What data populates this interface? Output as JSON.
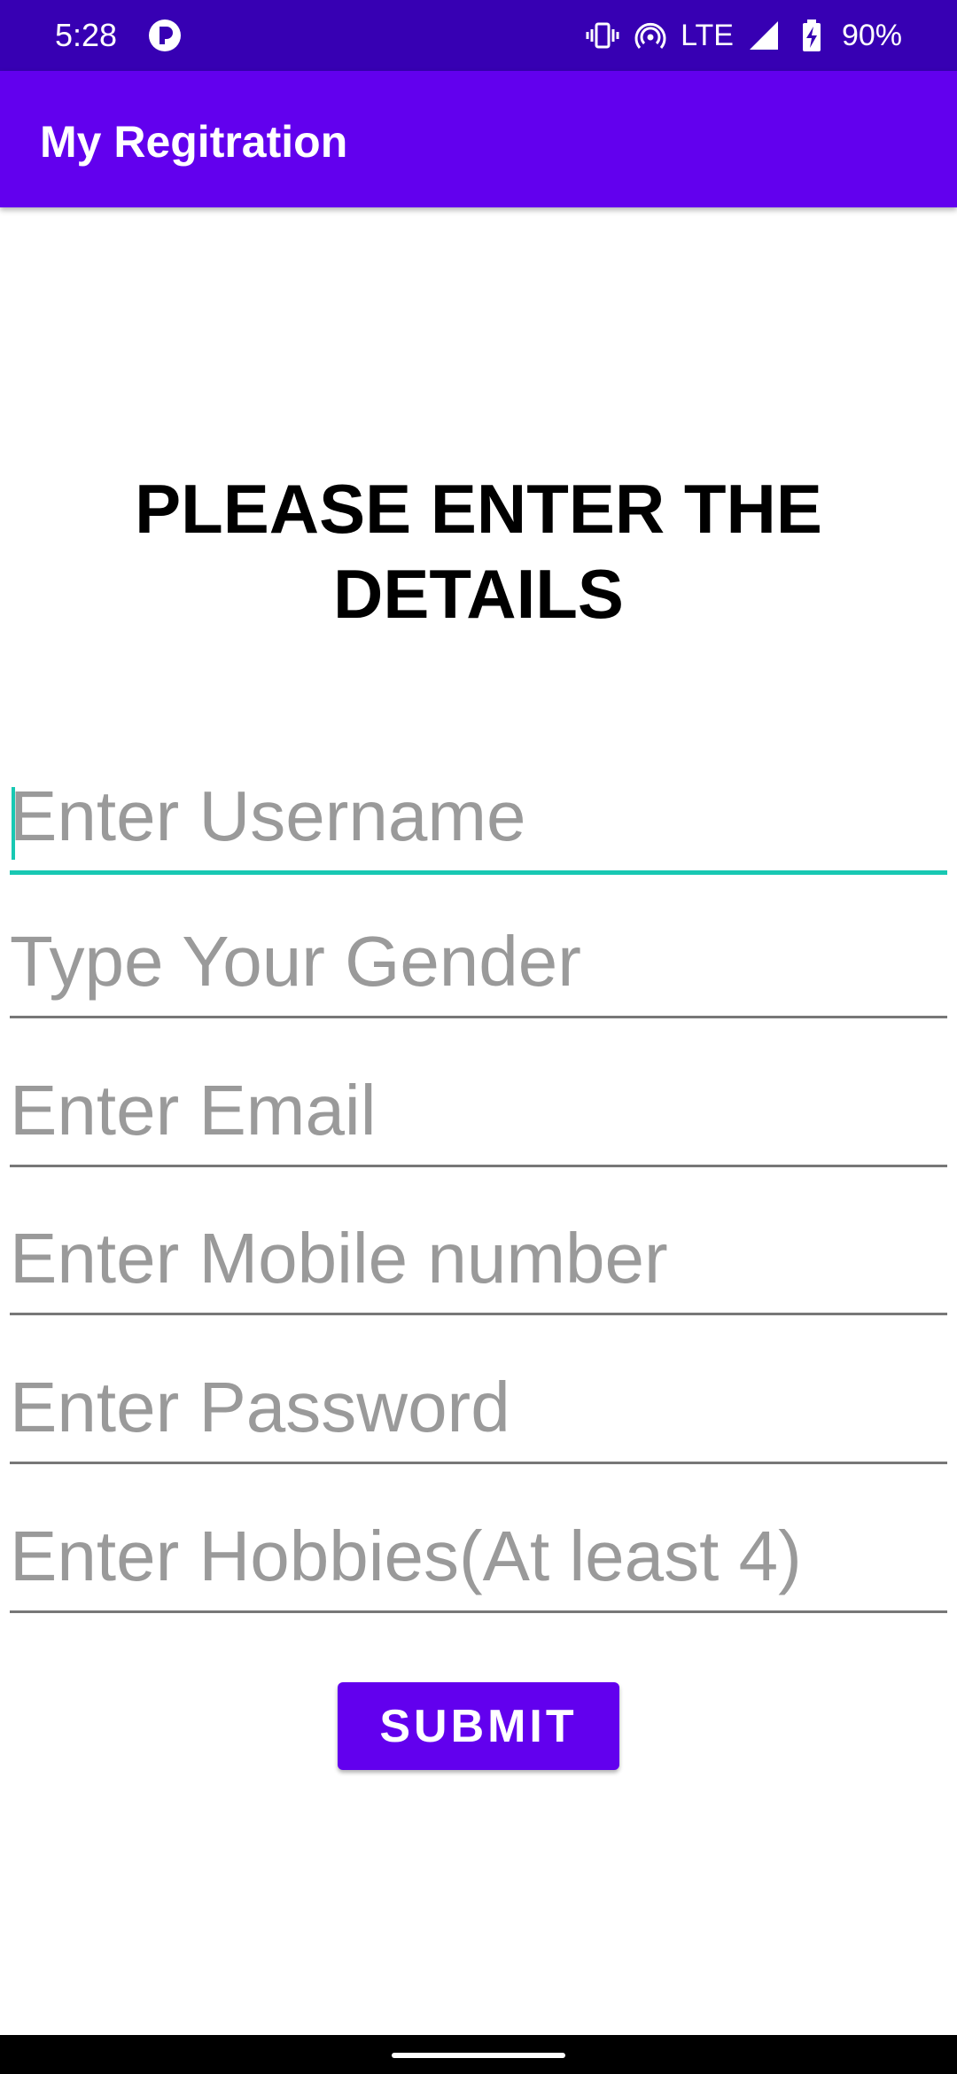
{
  "status_bar": {
    "time": "5:28",
    "network": "LTE",
    "battery": "90%",
    "icons": [
      "app-notification-icon",
      "vibrate-icon",
      "hotspot-icon",
      "signal-icon",
      "battery-charging-icon"
    ]
  },
  "app_bar": {
    "title": "My Regitration",
    "color": "#6200ee"
  },
  "form": {
    "heading": "PLEASE ENTER THE DETAILS",
    "username_placeholder": "Enter Username",
    "gender_placeholder": "Type Your Gender",
    "email_placeholder": "Enter Email",
    "mobile_placeholder": "Enter Mobile number",
    "password_placeholder": "Enter Password",
    "hobbies_placeholder": "Enter Hobbies(At least 4)",
    "submit_label": "SUBMIT",
    "focus_color": "#18c8b3"
  }
}
